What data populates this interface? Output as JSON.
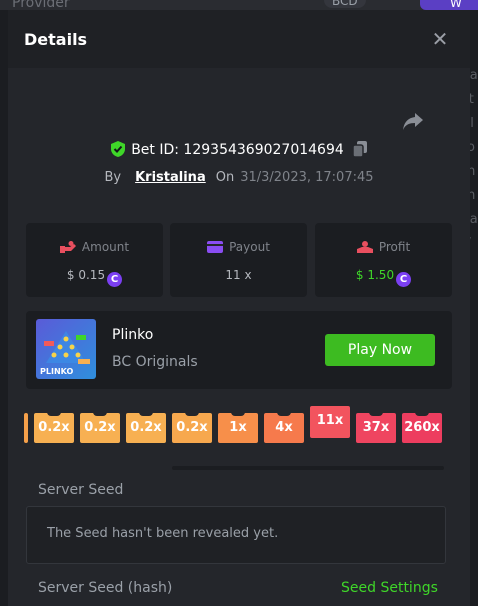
{
  "background": {
    "provider_label": "Provider",
    "currency_label": "BCD",
    "right_glyphs": [
      "va",
      "st",
      "nl",
      "ro",
      "th",
      "th",
      "l a",
      "",
      ":/"
    ],
    "overlay_label": "W"
  },
  "modal": {
    "title": "Details",
    "close_icon": "close-icon",
    "share_icon": "share-icon"
  },
  "bet": {
    "id_label": "Bet ID: 129354369027014694",
    "by_label": "By",
    "username": "Kristalina",
    "on_label": "On",
    "date": "31/3/2023, 17:07:45"
  },
  "stats": {
    "amount": {
      "label": "Amount",
      "value": "$ 0.15"
    },
    "payout": {
      "label": "Payout",
      "value": "11 x"
    },
    "profit": {
      "label": "Profit",
      "value": "$ 1.50"
    }
  },
  "coin_symbol": "C",
  "game": {
    "name": "Plinko",
    "provider": "BC Originals",
    "play_label": "Play Now",
    "thumb_label": "PLINKO"
  },
  "multipliers": [
    {
      "label": "",
      "color": "#f5a04a"
    },
    {
      "label": "0.2x",
      "color": "#f7b052"
    },
    {
      "label": "0.2x",
      "color": "#f7b052"
    },
    {
      "label": "0.2x",
      "color": "#f7b052"
    },
    {
      "label": "0.2x",
      "color": "#f7a84e"
    },
    {
      "label": "1x",
      "color": "#f78f4a"
    },
    {
      "label": "4x",
      "color": "#f67a4c"
    },
    {
      "label": "11x",
      "color": "#f2545e"
    },
    {
      "label": "37x",
      "color": "#ef4560"
    },
    {
      "label": "260x",
      "color": "#ed3d5f"
    }
  ],
  "active_multiplier": 7,
  "seeds": {
    "server_seed_label": "Server Seed",
    "server_seed_value": "The Seed hasn't been revealed yet.",
    "server_seed_hash_label": "Server Seed (hash)",
    "seed_settings_label": "Seed Settings"
  },
  "colors": {
    "accent_green": "#3dbb21",
    "profit_green": "#3fd629",
    "coin_purple": "#7b3ff2",
    "shield_green": "#3fd629"
  }
}
